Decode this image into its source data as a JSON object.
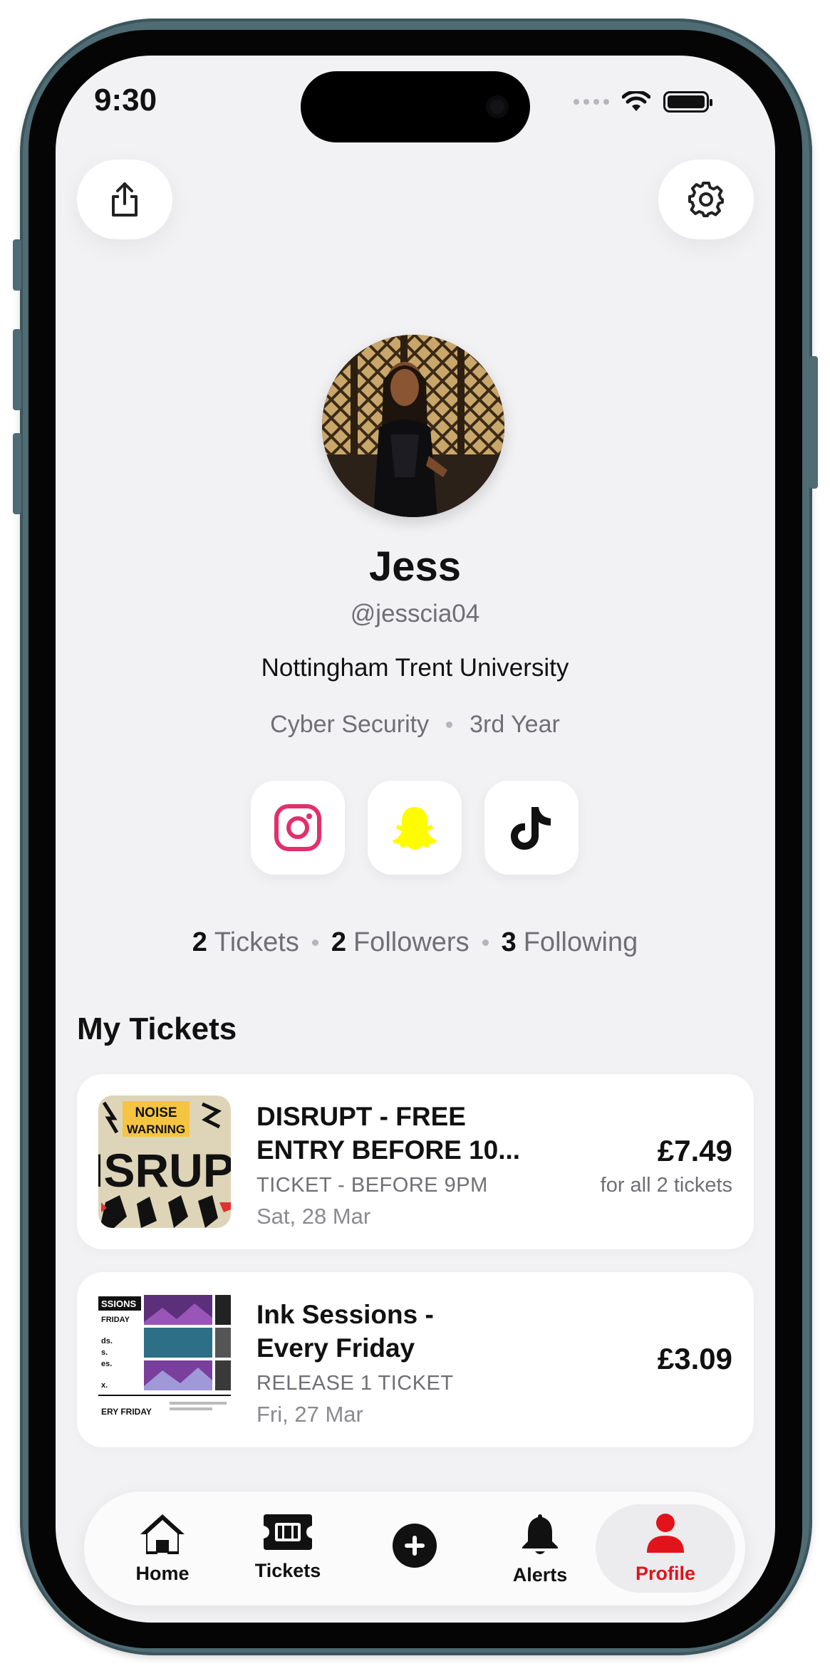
{
  "status_bar": {
    "time": "9:30"
  },
  "header": {
    "share_icon": "share-icon",
    "settings_icon": "gear-icon"
  },
  "profile": {
    "name": "Jess",
    "handle": "@jesscia04",
    "university": "Nottingham Trent University",
    "course": "Cyber Security",
    "year": "3rd Year"
  },
  "socials": [
    {
      "icon": "instagram-icon",
      "color": "#e1306c"
    },
    {
      "icon": "snapchat-icon",
      "color": "#fffc00"
    },
    {
      "icon": "tiktok-icon",
      "color": "#111111"
    }
  ],
  "stats": [
    {
      "count": "2",
      "label": "Tickets"
    },
    {
      "count": "2",
      "label": "Followers"
    },
    {
      "count": "3",
      "label": "Following"
    }
  ],
  "section_title": "My Tickets",
  "tickets": [
    {
      "title_line1": "DISRUPT - FREE",
      "title_line2": "ENTRY BEFORE 10...",
      "type": "TICKET - BEFORE 9PM",
      "date": "Sat, 28 Mar",
      "price": "£7.49",
      "price_note": "for all 2 tickets",
      "poster_top": "NOISE",
      "poster_top2": "WARNING",
      "poster_main": "ISRUP"
    },
    {
      "title_line1": "Ink Sessions -",
      "title_line2": "Every Friday",
      "type": "RELEASE 1 TICKET",
      "date": "Fri, 27 Mar",
      "price": "£3.09",
      "poster_top": "SSIONS",
      "poster_sub": "FRIDAY",
      "poster_lines": [
        "ds.",
        "s.",
        "es.",
        "x."
      ],
      "poster_bottom": "ERY FRIDAY"
    }
  ],
  "tabbar": {
    "items": [
      {
        "label": "Home",
        "icon": "home-icon"
      },
      {
        "label": "Tickets",
        "icon": "ticket-icon"
      },
      {
        "label": "",
        "icon": "plus-icon"
      },
      {
        "label": "Alerts",
        "icon": "bell-icon"
      },
      {
        "label": "Profile",
        "icon": "person-icon"
      }
    ],
    "active": "Profile",
    "accent": "#e0141a"
  }
}
